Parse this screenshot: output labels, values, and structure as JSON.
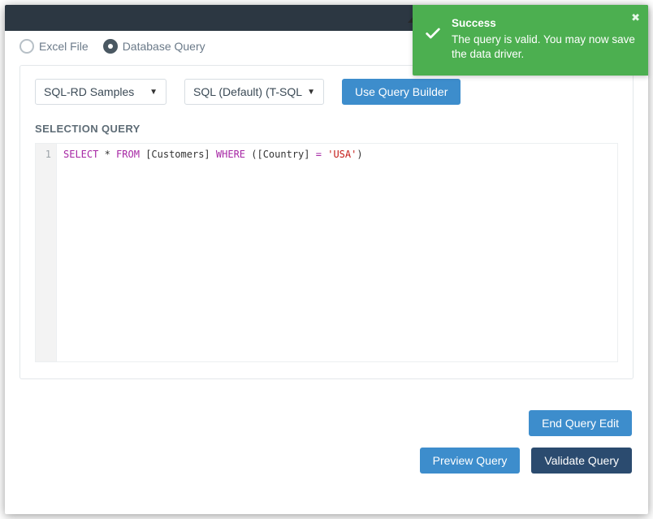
{
  "radio": {
    "excel_label": "Excel File",
    "db_label": "Database Query"
  },
  "toolbar": {
    "datasource_selected": "SQL-RD Samples",
    "dialect_selected": "SQL (Default) (T-SQL)",
    "query_builder_label": "Use Query Builder"
  },
  "editor": {
    "section_title": "SELECTION QUERY",
    "line_number": "1",
    "tokens": {
      "select": "SELECT",
      "star": " * ",
      "from": "FROM",
      "sp1": " ",
      "table": "[Customers]",
      "sp2": " ",
      "where": "WHERE",
      "sp3": " (",
      "col": "[Country]",
      "sp4": " ",
      "eq": "=",
      "sp5": " ",
      "val": "'USA'",
      "close": ")"
    }
  },
  "buttons": {
    "end_edit": "End Query Edit",
    "preview": "Preview Query",
    "validate": "Validate Query"
  },
  "toast": {
    "title": "Success",
    "message": "The query is valid. You may now save the data driver."
  }
}
